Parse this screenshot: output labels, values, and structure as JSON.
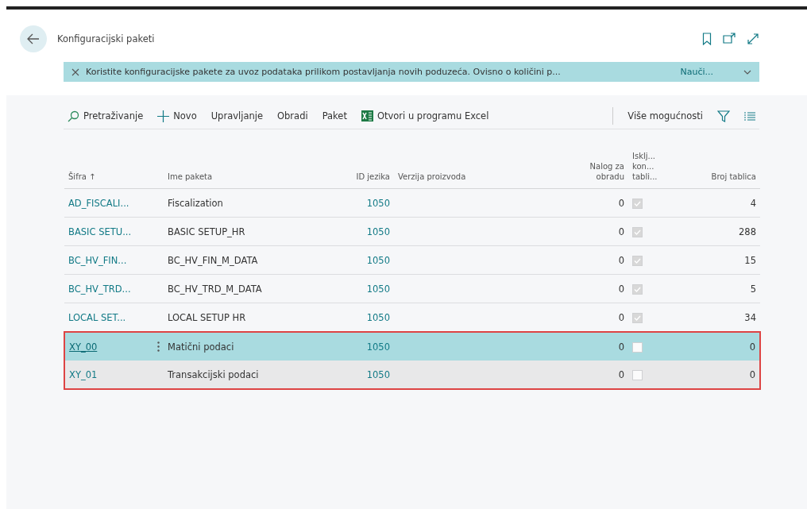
{
  "page": {
    "title": "Konfiguracijski paketi"
  },
  "banner": {
    "text": "Koristite konfiguracijske pakete za uvoz podataka prilikom postavljanja novih poduzeća. Ovisno o količini p...",
    "link": "Nauči..."
  },
  "toolbar": {
    "actions": [
      {
        "kind": "search",
        "label": "Pretraživanje"
      },
      {
        "kind": "new",
        "label": "Novo"
      },
      {
        "kind": "plain",
        "label": "Upravljanje"
      },
      {
        "kind": "plain",
        "label": "Obradi"
      },
      {
        "kind": "plain",
        "label": "Paket"
      },
      {
        "kind": "excel",
        "label": "Otvori u programu Excel"
      }
    ],
    "more": "Više mogućnosti"
  },
  "table": {
    "columns": [
      {
        "label": "Šifra ↑"
      },
      {
        "label": "Ime paketa"
      },
      {
        "label": "ID jezika"
      },
      {
        "label": "Verzija proizvoda"
      },
      {
        "label": "Nalog za obradu"
      },
      {
        "label": "Isklj... kon... tabli..."
      },
      {
        "label": "Broj tablica"
      }
    ],
    "rows": [
      {
        "code": "AD_FISCALI...",
        "name": "Fiscalization",
        "language_id": "1050",
        "processing_order": "0",
        "excluded": true,
        "table_count": "4",
        "selected": false,
        "hovered": false,
        "outlined": false
      },
      {
        "code": "BASIC SETU...",
        "name": "BASIC SETUP_HR",
        "language_id": "1050",
        "processing_order": "0",
        "excluded": true,
        "table_count": "288",
        "selected": false,
        "hovered": false,
        "outlined": false
      },
      {
        "code": "BC_HV_FIN...",
        "name": "BC_HV_FIN_M_DATA",
        "language_id": "1050",
        "processing_order": "0",
        "excluded": true,
        "table_count": "15",
        "selected": false,
        "hovered": false,
        "outlined": false
      },
      {
        "code": "BC_HV_TRD...",
        "name": "BC_HV_TRD_M_DATA",
        "language_id": "1050",
        "processing_order": "0",
        "excluded": true,
        "table_count": "5",
        "selected": false,
        "hovered": false,
        "outlined": false
      },
      {
        "code": "LOCAL SET...",
        "name": "LOCAL SETUP HR",
        "language_id": "1050",
        "processing_order": "0",
        "excluded": true,
        "table_count": "34",
        "selected": false,
        "hovered": false,
        "outlined": false
      },
      {
        "code": "XY_00",
        "name": "Matični podaci",
        "language_id": "1050",
        "processing_order": "0",
        "excluded": false,
        "table_count": "0",
        "selected": true,
        "hovered": false,
        "outlined": true
      },
      {
        "code": "XY_01",
        "name": "Transakcijski podaci",
        "language_id": "1050",
        "processing_order": "0",
        "excluded": false,
        "table_count": "0",
        "selected": false,
        "hovered": true,
        "outlined": true
      }
    ]
  }
}
